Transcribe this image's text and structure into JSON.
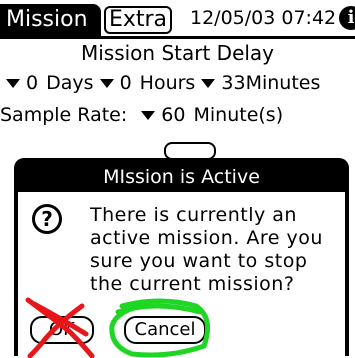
{
  "titlebar": {
    "active_tab": "Mission",
    "inactive_tab": "Extra",
    "clock": "12/05/03 07:42",
    "info_icon": "i"
  },
  "form": {
    "heading": "Mission Start Delay",
    "delay_days_value": "0",
    "delay_days_unit": "Days",
    "delay_hours_value": "0",
    "delay_hours_unit": "Hours",
    "delay_minutes_value": "33",
    "delay_minutes_unit": "Minutes",
    "sample_rate_label": "Sample Rate:",
    "sample_rate_value": "60",
    "sample_rate_unit": "Minute(s)"
  },
  "dialog": {
    "title": "MIssion is Active",
    "icon": "?",
    "message": "There is currently an active mission. Are you sure you want to stop the current mission?",
    "ok_label": "OK",
    "cancel_label": "Cancel"
  },
  "colors": {
    "background": "#ffffff",
    "foreground": "#000000",
    "annotation_red": "#e8151b",
    "annotation_green": "#1fd624"
  }
}
